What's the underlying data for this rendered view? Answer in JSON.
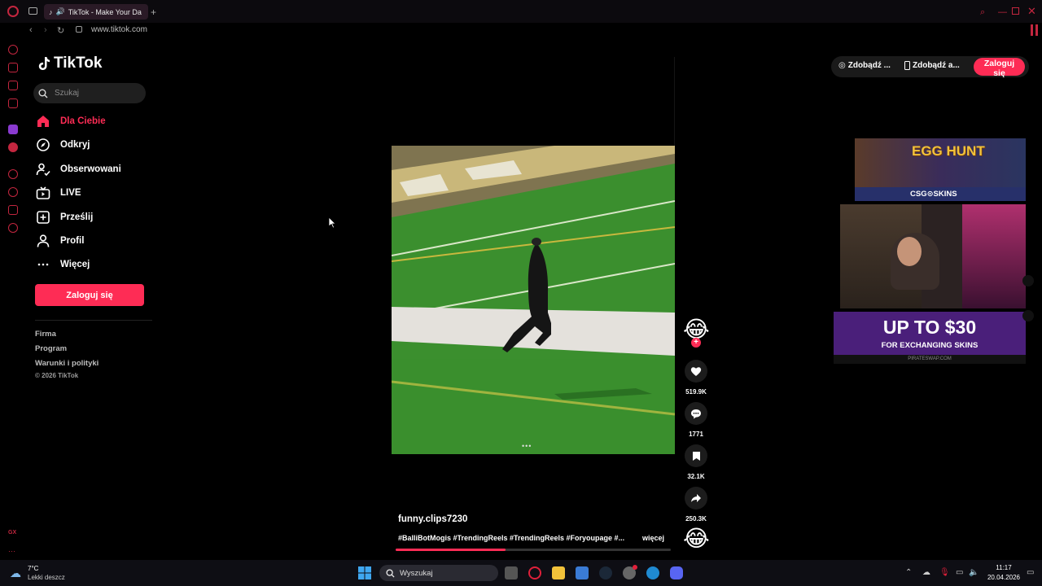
{
  "browser": {
    "tab_title": "TikTok - Make Your Da",
    "url": "www.tiktok.com",
    "new_tab": "+"
  },
  "sidebar": {
    "logo": "TikTok",
    "search_placeholder": "Szukaj",
    "items": [
      {
        "label": "Dla Ciebie",
        "icon": "home-icon",
        "active": true
      },
      {
        "label": "Odkryj",
        "icon": "compass-icon"
      },
      {
        "label": "Obserwowani",
        "icon": "following-icon"
      },
      {
        "label": "LIVE",
        "icon": "live-tv-icon"
      },
      {
        "label": "Prześlij",
        "icon": "upload-icon"
      },
      {
        "label": "Profil",
        "icon": "profile-icon"
      },
      {
        "label": "Więcej",
        "icon": "more-dots-icon"
      }
    ],
    "login_label": "Zaloguj się",
    "footer_links": [
      "Firma",
      "Program",
      "Warunki i polityki"
    ],
    "copyright": "© 2026 TikTok"
  },
  "topright": {
    "get_coins": "Zdobądź ...",
    "get_app": "Zdobądź a...",
    "login": "Zaloguj się"
  },
  "video": {
    "username": "funny.clips7230",
    "tags": "#BalliBotMogis #TrendingReels #TrendingReels #Foryoupage #...",
    "more": "więcej",
    "likes": "519.9K",
    "comments": "1771",
    "saves": "32.1K",
    "shares": "250.3K",
    "progress": 0.4,
    "menu_dots": "•••"
  },
  "ads": {
    "egg_hunt": "EGG HUNT",
    "csg_skins": "CSG⊙SKINS",
    "promo_line1": "UP TO $30",
    "promo_line2": "FOR EXCHANGING SKINS",
    "promo_site": "PIRATESWAP.COM"
  },
  "taskbar": {
    "weather_temp": "7°C",
    "weather_desc": "Lekki deszcz",
    "search": "Wyszukaj",
    "time": "11:17",
    "date": "20.04.2026"
  },
  "colors": {
    "accent": "#fe2c55",
    "opera_red": "#c3263f"
  }
}
